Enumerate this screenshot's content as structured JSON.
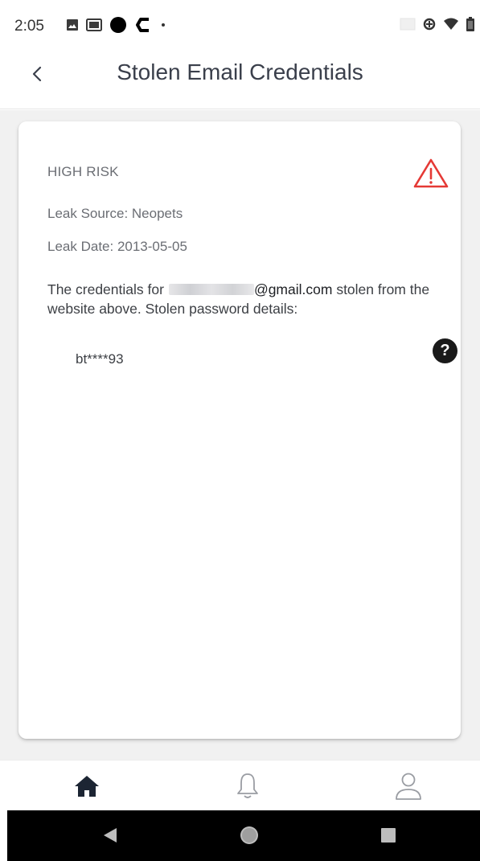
{
  "status_bar": {
    "time": "2:05",
    "left_icons": [
      "image-icon",
      "photo-icon",
      "circle-icon",
      "c-logo-icon",
      "dot-icon"
    ],
    "right_icons": [
      "cast-icon",
      "data-saver-icon",
      "wifi-icon",
      "battery-icon"
    ]
  },
  "header": {
    "back_icon": "chevron-left-icon",
    "title": "Stolen Email Credentials"
  },
  "card": {
    "risk_label": "HIGH RISK",
    "risk_icon": "warning-triangle-icon",
    "risk_color": "#e53935",
    "leak_source": "Leak Source: Neopets",
    "leak_date": "Leak Date:  2013-05-05",
    "cred_text_before": "The credentials for",
    "email_domain": "@gmail.com",
    "cred_text_after": " stolen from the website above. Stolen password details:",
    "password_masked": "bt****93",
    "help_icon": "?"
  },
  "bottom_nav": {
    "items": [
      {
        "icon": "home-icon",
        "active": true
      },
      {
        "icon": "bell-icon",
        "active": false
      },
      {
        "icon": "person-icon",
        "active": false
      }
    ]
  },
  "system_nav": {
    "buttons": [
      "back-triangle-icon",
      "home-circle-icon",
      "recents-square-icon"
    ]
  }
}
